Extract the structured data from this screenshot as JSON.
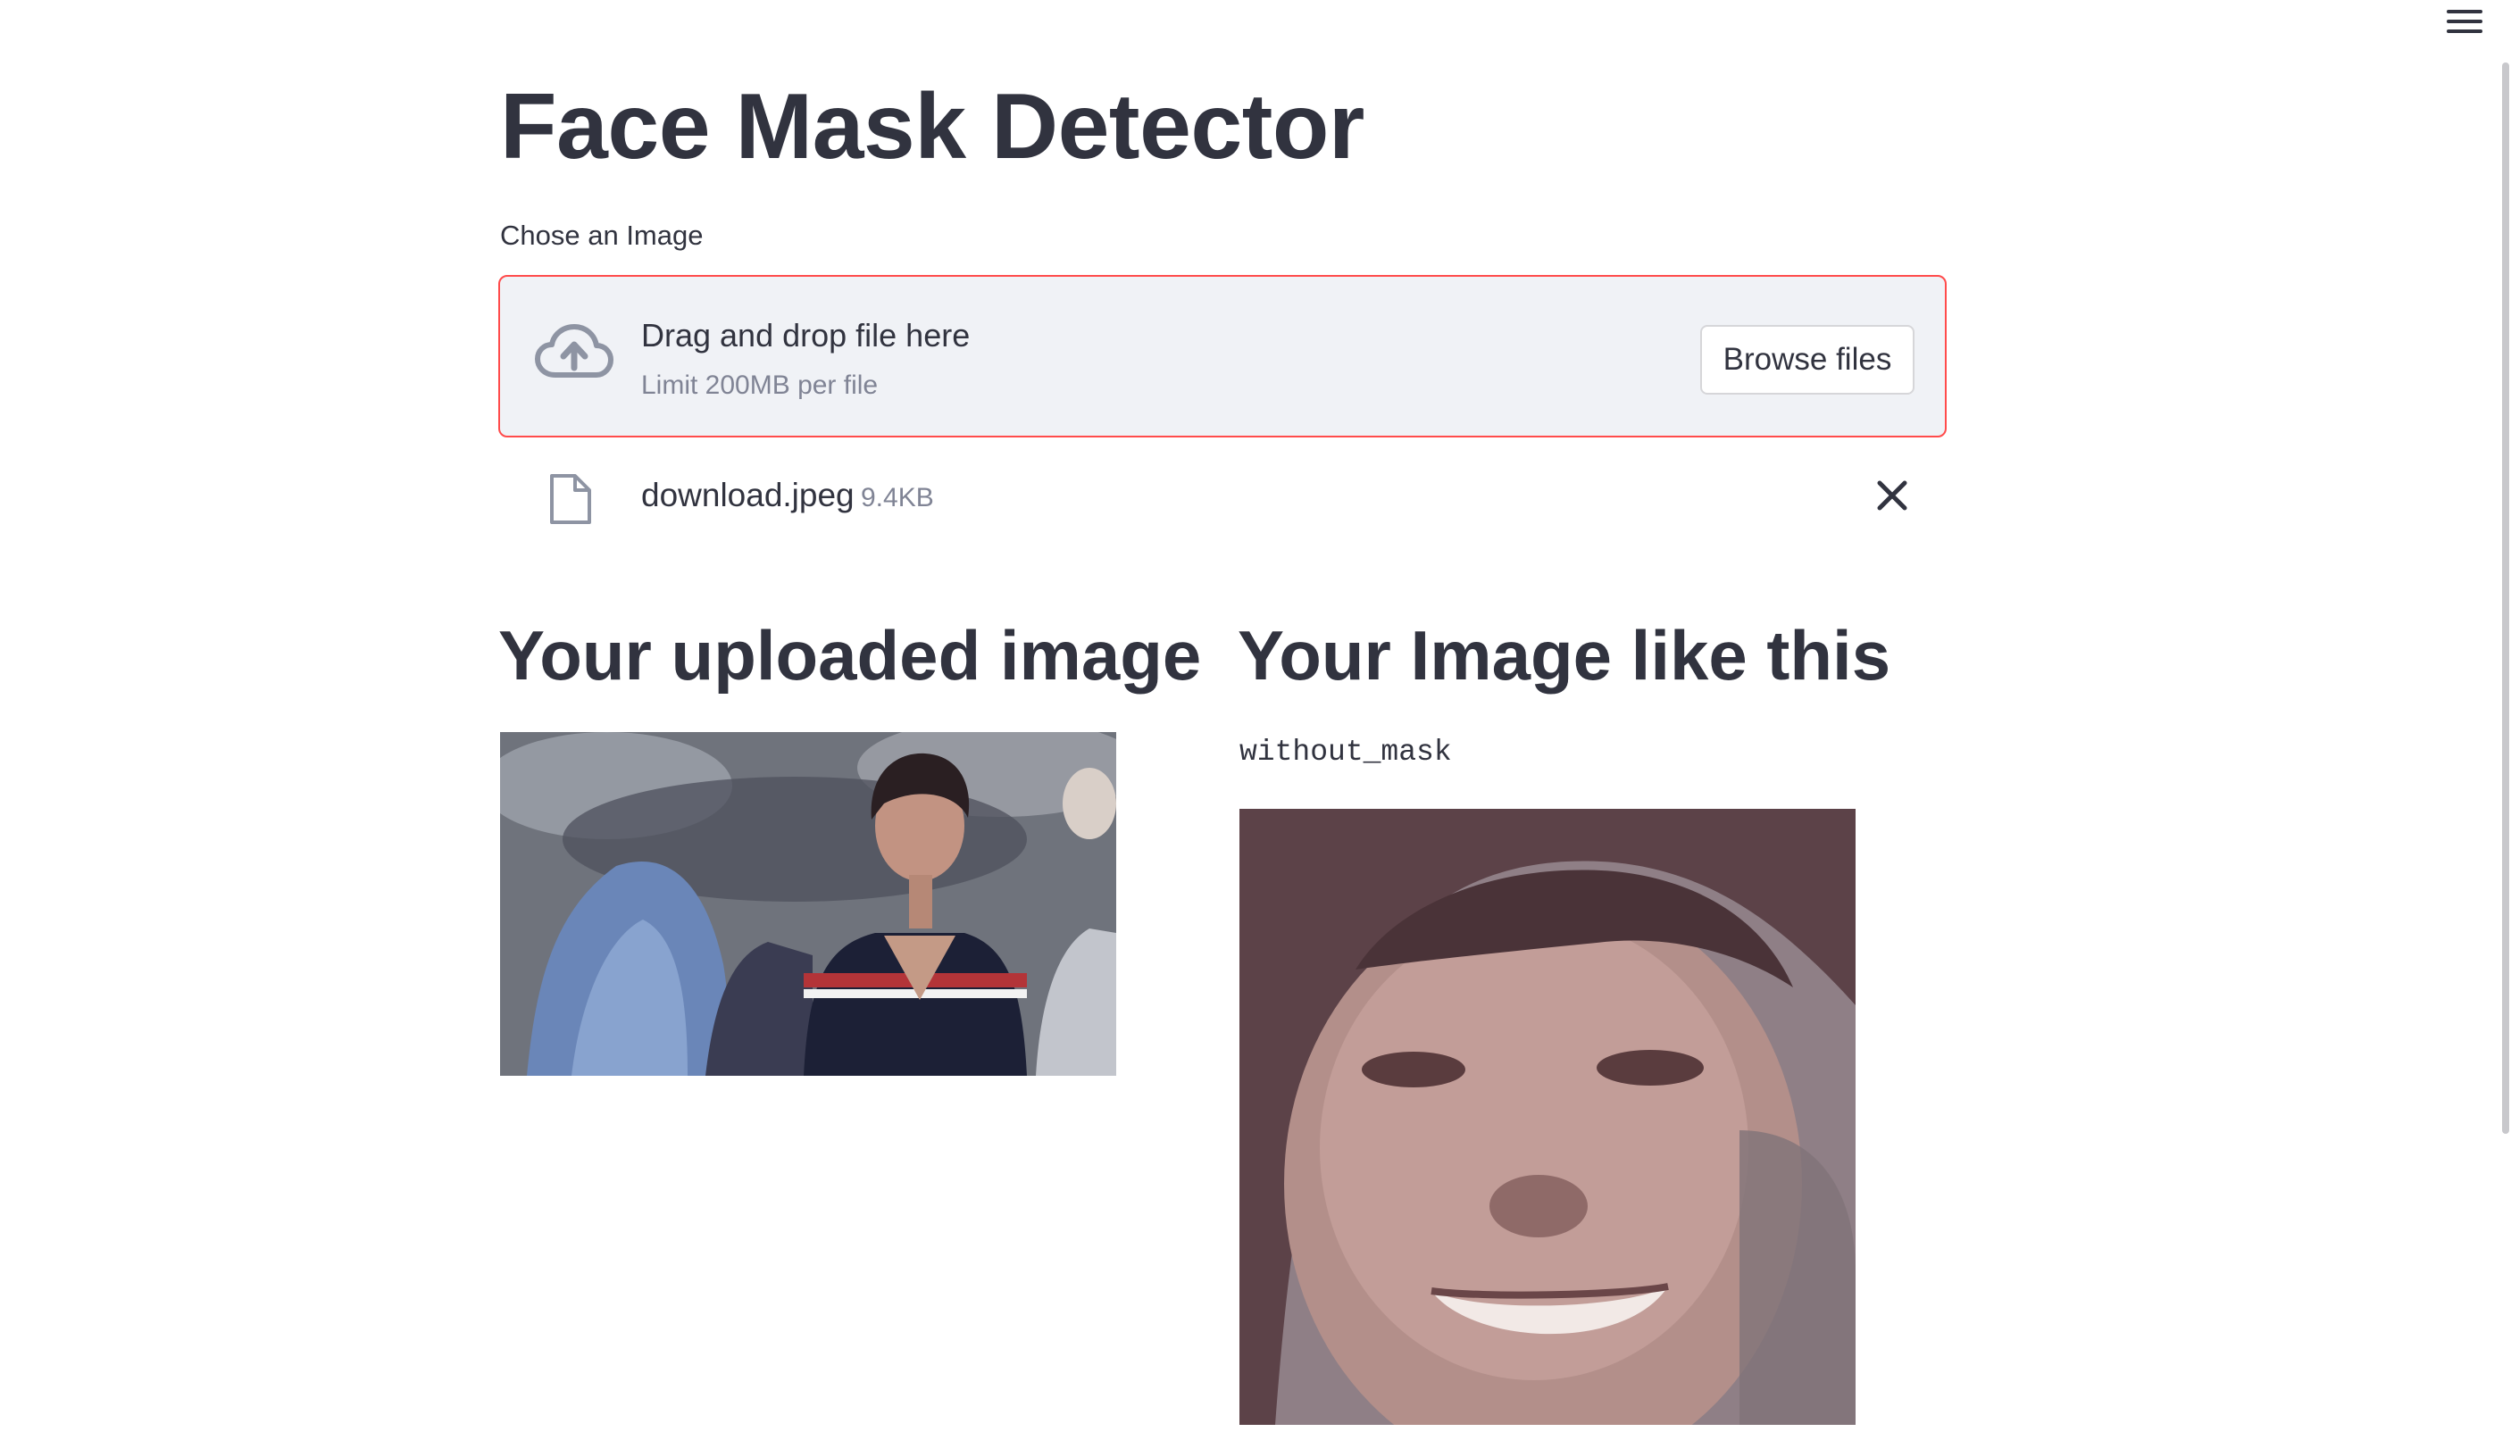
{
  "app": {
    "title": "Face Mask Detector"
  },
  "uploader": {
    "label": "Chose an Image",
    "drop_text": "Drag and drop file here",
    "limit_text": "Limit 200MB per file",
    "browse_label": "Browse files",
    "accent_color": "#ff4b4b"
  },
  "file": {
    "name": "download.jpeg",
    "size": "9.4KB"
  },
  "results": {
    "left_heading": "Your uploaded image",
    "right_heading": "Your Image like this",
    "prediction": "without_mask"
  },
  "icons": {
    "menu": "hamburger-menu-icon",
    "upload": "cloud-upload-icon",
    "file": "file-icon",
    "remove": "close-icon"
  }
}
